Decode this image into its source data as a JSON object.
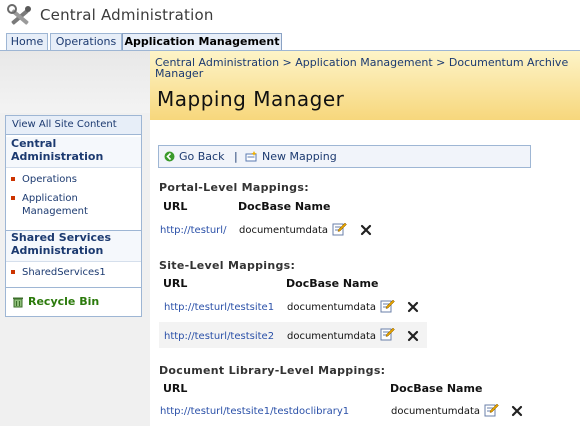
{
  "header": {
    "title": "Central Administration"
  },
  "tabs": [
    {
      "label": "Home"
    },
    {
      "label": "Operations"
    },
    {
      "label": "Application Management"
    }
  ],
  "nav": {
    "view_all": "View All Site Content",
    "central_admin": [
      "Central",
      "Administration"
    ],
    "items_ca": [
      {
        "label": [
          "Operations"
        ]
      },
      {
        "label": [
          "Application",
          "Management"
        ]
      }
    ],
    "shared_services": [
      "Shared Services",
      "Administration"
    ],
    "items_ss": [
      {
        "label": [
          "SharedServices1"
        ]
      }
    ],
    "recycle_bin": "Recycle Bin"
  },
  "breadcrumb": [
    "Central Administration > Application Management > Documentum Archive",
    "Manager"
  ],
  "page_title": "Mapping Manager",
  "toolbar": {
    "go_back": "Go Back",
    "separator": "|",
    "new_mapping": "New Mapping"
  },
  "sections": {
    "portal": {
      "title": "Portal-Level Mappings:",
      "col_url": "URL",
      "col_docbase": "DocBase Name",
      "rows": [
        {
          "url": "http://testurl/",
          "docbase": "documentumdata"
        }
      ]
    },
    "site": {
      "title": "Site-Level Mappings:",
      "col_url": "URL",
      "col_docbase": "DocBase Name",
      "rows": [
        {
          "url": "http://testurl/testsite1",
          "docbase": "documentumdata"
        },
        {
          "url": "http://testurl/testsite2",
          "docbase": "documentumdata"
        }
      ]
    },
    "doclib": {
      "title": "Document Library-Level Mappings:",
      "col_url": "URL",
      "col_docbase": "DocBase Name",
      "rows": [
        {
          "url": "http://testurl/testsite1/testdoclibrary1",
          "docbase": "documentumdata"
        }
      ]
    }
  },
  "icons": {
    "app": "tools-icon",
    "go_back": "go-back-icon",
    "new_mapping": "new-item-icon",
    "edit": "edit-icon",
    "delete": "delete-icon",
    "recycle": "recycle-bin-icon"
  },
  "colors": {
    "link": "#2a50a8",
    "title_band": "#f7d77c",
    "nav_heading": "#1c3a70",
    "recycle": "#2b7a0b"
  }
}
